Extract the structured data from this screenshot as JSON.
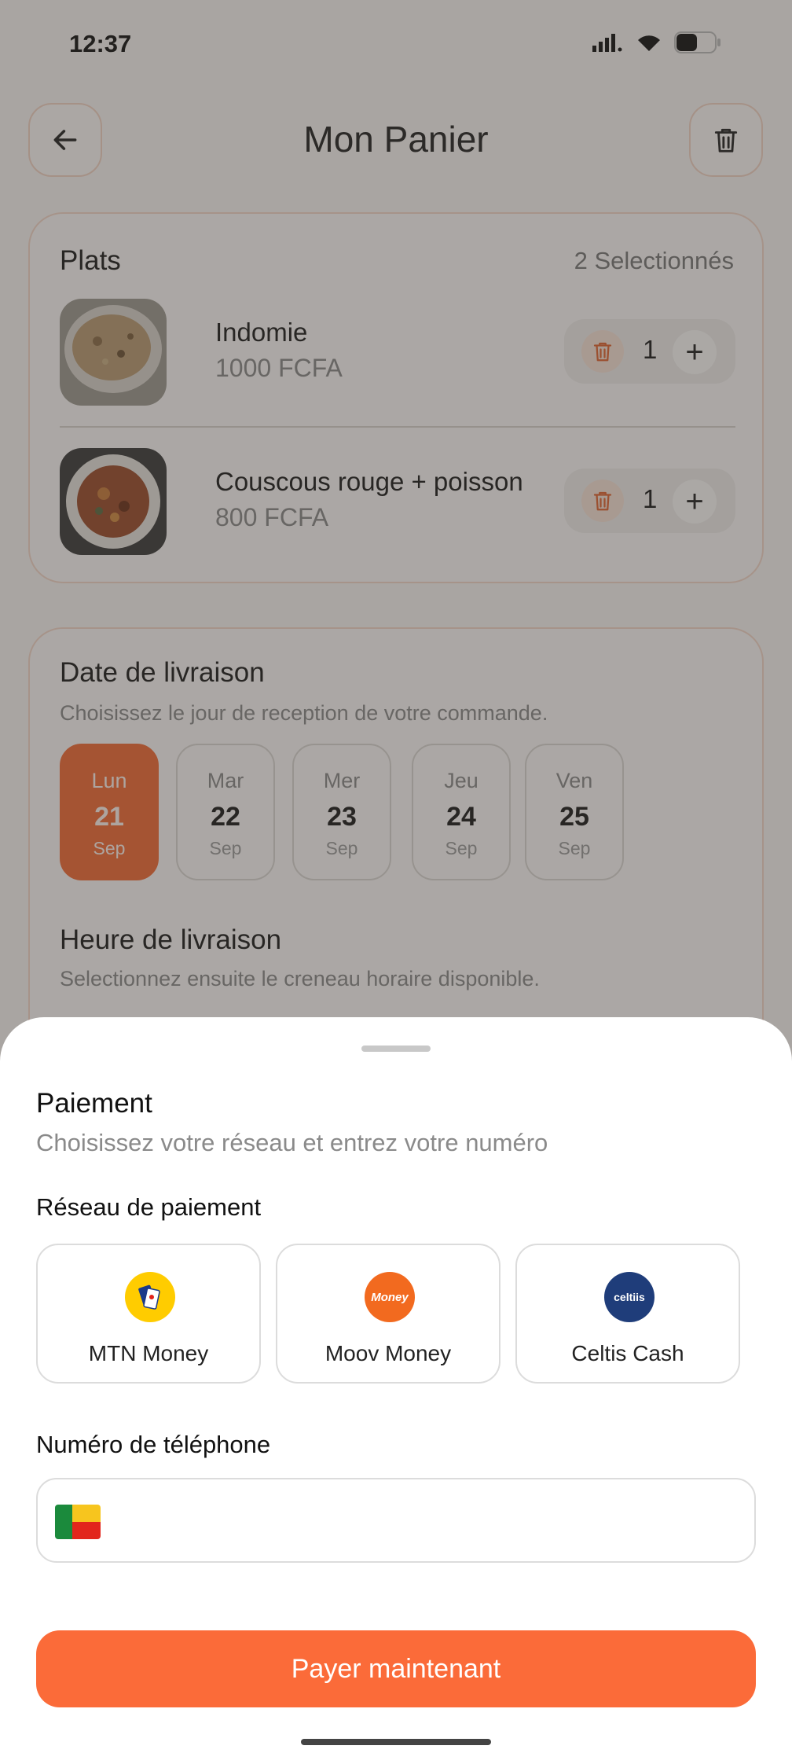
{
  "status_bar": {
    "time": "12:37"
  },
  "header": {
    "title": "Mon Panier",
    "back_icon": "arrow-left-icon",
    "trash_icon": "trash-icon"
  },
  "plats": {
    "title": "Plats",
    "count_label": "2 Selectionnés",
    "items": [
      {
        "name": "Indomie",
        "price": "1000 FCFA",
        "quantity": "1",
        "plus": "+"
      },
      {
        "name": "Couscous rouge + poisson",
        "price": "800 FCFA",
        "quantity": "1",
        "plus": "+"
      }
    ]
  },
  "delivery": {
    "date_title": "Date de livraison",
    "date_subtitle": "Choisissez le jour de reception de votre commande.",
    "days": [
      {
        "name": "Lun",
        "date": "21",
        "month": "Sep",
        "selected": true
      },
      {
        "name": "Mar",
        "date": "22",
        "month": "Sep",
        "selected": false
      },
      {
        "name": "Mer",
        "date": "23",
        "month": "Sep",
        "selected": false
      },
      {
        "name": "Jeu",
        "date": "24",
        "month": "Sep",
        "selected": false
      },
      {
        "name": "Ven",
        "date": "25",
        "month": "Sep",
        "selected": false
      }
    ],
    "time_title": "Heure de livraison",
    "time_subtitle": "Selectionnez ensuite le creneau horaire disponible."
  },
  "payment": {
    "title": "Paiement",
    "subtitle": "Choisissez votre réseau et entrez votre numéro",
    "network_label": "Réseau de paiement",
    "networks": [
      {
        "name": "MTN Money",
        "logo_text": "",
        "color": "#ffcc00"
      },
      {
        "name": "Moov Money",
        "logo_text": "Money",
        "color": "#f26a1f"
      },
      {
        "name": "Celtis Cash",
        "logo_text": "celtiis",
        "color": "#1f3d7a"
      }
    ],
    "phone_label": "Numéro de téléphone",
    "phone_value": "",
    "phone_placeholder": "",
    "country_flag": "benin-flag-icon",
    "pay_button": "Payer maintenant"
  },
  "colors": {
    "accent": "#fb6b39",
    "selected_day": "#f26a35"
  }
}
